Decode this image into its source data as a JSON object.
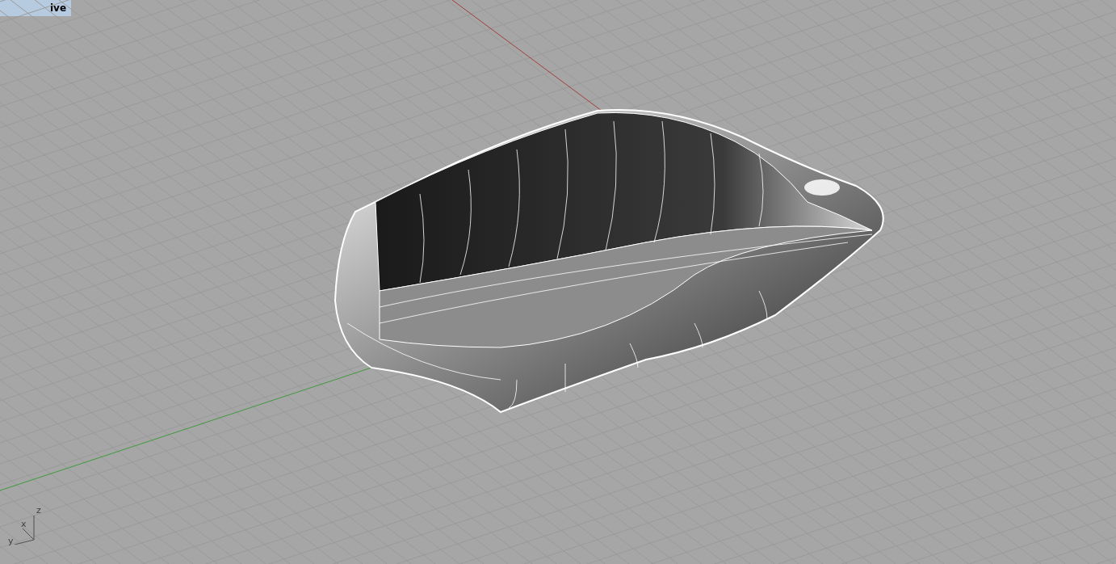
{
  "viewport": {
    "label": "ive"
  },
  "axis_icon": {
    "z_label": "z",
    "x_label": "x",
    "y_label": "y"
  }
}
